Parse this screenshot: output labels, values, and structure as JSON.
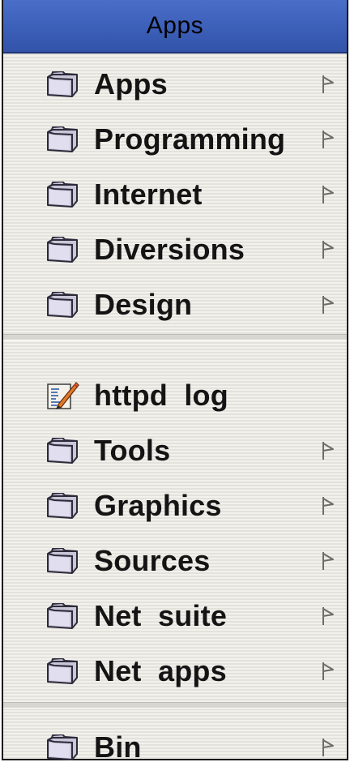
{
  "menu": {
    "title": "Apps",
    "group1": [
      {
        "label": "Apps",
        "icon": "folder-icon",
        "submenu": true
      },
      {
        "label": "Programming",
        "icon": "folder-icon",
        "submenu": true
      },
      {
        "label": "Internet",
        "icon": "folder-icon",
        "submenu": true
      },
      {
        "label": "Diversions",
        "icon": "folder-icon",
        "submenu": true
      },
      {
        "label": "Design",
        "icon": "folder-icon",
        "submenu": true
      }
    ],
    "group2": [
      {
        "label": "httpd  log",
        "icon": "document-edit-icon",
        "submenu": false
      },
      {
        "label": "Tools",
        "icon": "folder-icon",
        "submenu": true
      },
      {
        "label": "Graphics",
        "icon": "folder-icon",
        "submenu": true
      },
      {
        "label": "Sources",
        "icon": "folder-icon",
        "submenu": true
      },
      {
        "label": "Net  suite",
        "icon": "folder-icon",
        "submenu": true
      },
      {
        "label": "Net  apps",
        "icon": "folder-icon",
        "submenu": true
      }
    ],
    "group3": [
      {
        "label": "Bin",
        "icon": "folder-icon",
        "submenu": true
      }
    ],
    "colors": {
      "title_bar": "#3c5fb8",
      "menu_background": "#eceae4"
    }
  }
}
